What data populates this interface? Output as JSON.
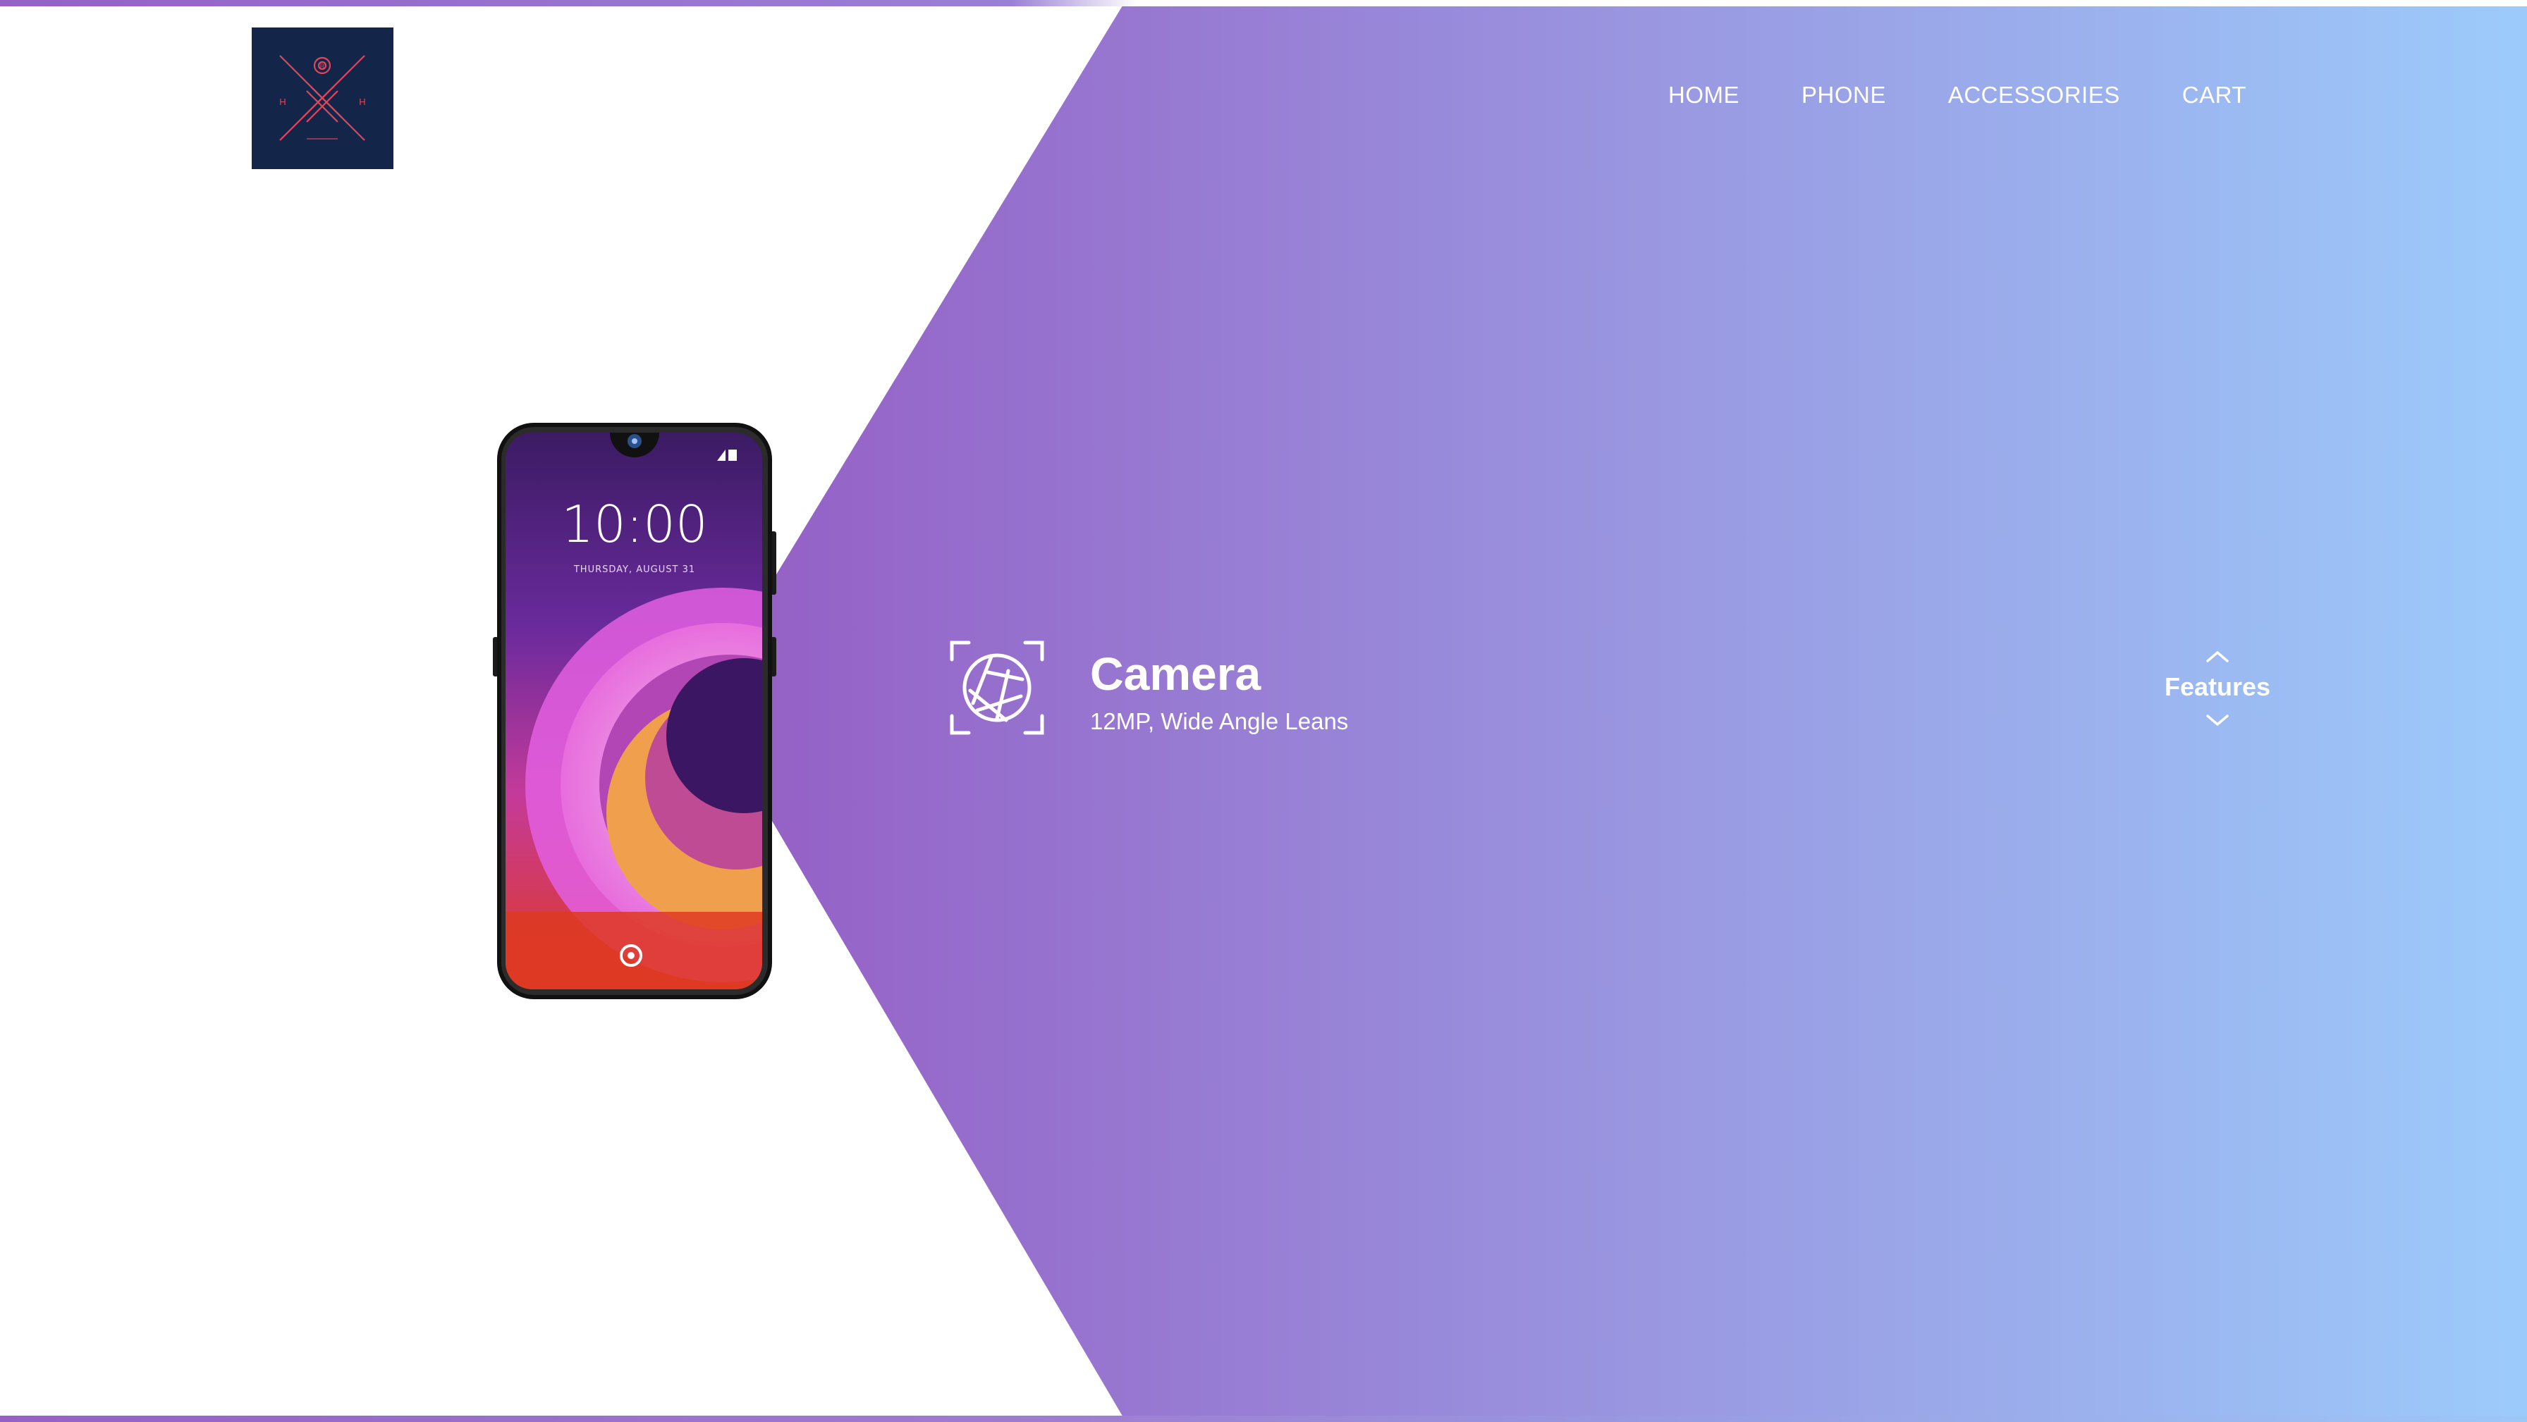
{
  "logo": {
    "icon": "hhr-monogram-logo",
    "letters": [
      "R",
      "H",
      "H"
    ],
    "background_color": "#14254a",
    "accent_color": "#e0475a"
  },
  "nav": {
    "items": [
      {
        "label": "HOME"
      },
      {
        "label": "PHONE"
      },
      {
        "label": "ACCESSORIES"
      },
      {
        "label": "CART"
      }
    ]
  },
  "hero": {
    "gradient_colors": [
      "#9561c6",
      "#9a9ce3",
      "#9ccbfb"
    ],
    "phone": {
      "clock_time": "10:00",
      "clock_date": "THURSDAY, AUGUST 31"
    }
  },
  "feature": {
    "icon": "camera-aperture-icon",
    "title": "Camera",
    "description": "12MP, Wide Angle Leans"
  },
  "features_nav": {
    "label": "Features",
    "up_icon": "chevron-up-icon",
    "down_icon": "chevron-down-icon"
  }
}
